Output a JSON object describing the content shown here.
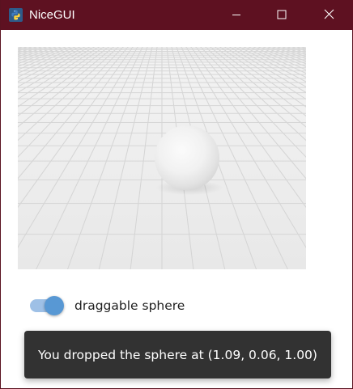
{
  "window": {
    "title": "NiceGUI",
    "titlebar_color": "#5e1121",
    "app_icon": "python-logo-icon",
    "controls": [
      "minimize-icon",
      "maximize-icon",
      "close-icon"
    ]
  },
  "scene": {
    "object": "sphere",
    "floor": "grid",
    "background_color": "#ededed"
  },
  "toggle": {
    "label": "draggable sphere",
    "checked": true,
    "accent_color": "#5898d4"
  },
  "notification": {
    "message": "You dropped the sphere at (1.09, 0.06, 1.00)"
  }
}
